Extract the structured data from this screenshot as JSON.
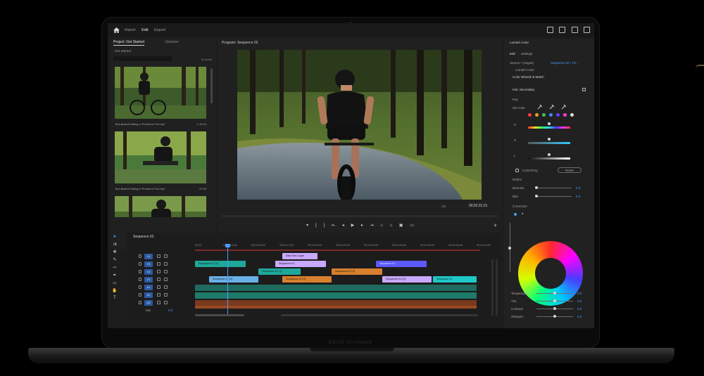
{
  "top_nav": {
    "import": "Import",
    "edit": "Edit",
    "export": "Export"
  },
  "project_panel": {
    "tab_project": "Project: Get Started",
    "tab_libraries": "Libraries",
    "path": "Get Started",
    "item_count": "31 items",
    "clips": [
      {
        "name": "Text-Based Editing in Premiere Pro.mp4",
        "duration": "1:19:15"
      },
      {
        "name": "Text-Based Editing in Premiere Pro.mp4",
        "duration": "47:18"
      }
    ]
  },
  "program_monitor": {
    "title": "Program: Sequence 02",
    "fit_label": "1/2",
    "timecode": "00;52;31;21"
  },
  "lumetri": {
    "title": "Lumetri Color",
    "tab_edit": "Edit",
    "tab_settings": "Settings",
    "source_label": "Source • (Vogue)",
    "source_sequence": "Sequence 02 • (Vi...",
    "fx_label": "Lumetri Color",
    "color_wheels": "Color Wheels & Match",
    "hsl_secondary": "HSL Secondary",
    "key": "Key",
    "set_color": "Set color",
    "h": "H",
    "s": "S",
    "l": "L",
    "color_gray": "Color/Gray",
    "reset": "Reset",
    "refine": "Refine",
    "denoise": "Denoise",
    "denoise_value": "0.0",
    "blur": "Blur",
    "blur_value": "0.0",
    "correction": "Correction",
    "temperature": "Temperature",
    "temperature_value": "0.0",
    "tint": "Tint",
    "tint_value": "0.0",
    "contrast": "Contrast",
    "contrast_value": "0.0",
    "sharpen": "Sharpen",
    "sharpen_value": "0.0",
    "swatch_colors": [
      "#ff3b3b",
      "#f0a020",
      "#40c060",
      "#3a8bff",
      "#6a3cff",
      "#ff3ce0",
      "#dddddd"
    ]
  },
  "timeline": {
    "sequence_name": "Sequence 02",
    "ruler": [
      "00;00",
      "00;00;04;00",
      "00;00;08;00",
      "00;00;12;00",
      "00;00;16;00",
      "00;00;20;00",
      "00;00;24;00",
      "00;00;28;00",
      "00;00;32;00",
      "00;00;36;00",
      "00;00;40;00"
    ],
    "tracks": [
      "V4",
      "V3",
      "V2",
      "V1",
      "A1",
      "A2",
      "A3"
    ],
    "mix_label": "Mix",
    "mix_value": "0.0",
    "clips": {
      "new_text_layer": "New Text Layer",
      "seq_v3_a": "Sequence 01 [V]",
      "seq_v3_b": "Sequence 01",
      "seq_v3_c": "Sequence 01",
      "seq_v2_a": "Sequence 01 [V]",
      "seq_v2_b": "Sequence 01 [V]",
      "seq_v1_a": "Sequence 01 [V]",
      "seq_v1_b": "Sequence 01 [V]",
      "seq_v1_c": "Sequence 01 [V]",
      "seq_v1_d": "Sequence 01"
    }
  },
  "laptop_brand": "ASUS Vivobook"
}
